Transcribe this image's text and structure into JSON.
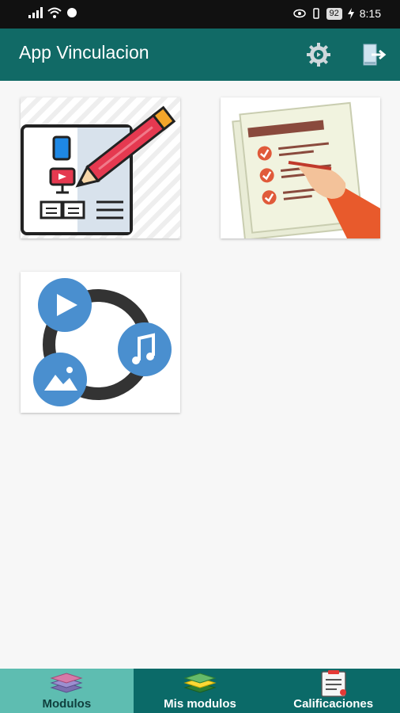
{
  "status_bar": {
    "time": "8:15",
    "battery": "92"
  },
  "app_bar": {
    "title": "App Vinculacion",
    "settings_icon": "gear-icon",
    "logout_icon": "logout-icon"
  },
  "modules": [
    {
      "icon": "pencil-document-icon"
    },
    {
      "icon": "checklist-icon"
    },
    {
      "icon": "multimedia-icon"
    }
  ],
  "bottom_nav": {
    "items": [
      {
        "label": "Modulos",
        "icon": "layers-icon",
        "active": true
      },
      {
        "label": "Mis modulos",
        "icon": "layers-green-icon",
        "active": false
      },
      {
        "label": "Calificaciones",
        "icon": "clipboard-icon",
        "active": false
      }
    ]
  },
  "colors": {
    "app_bar": "#116a66",
    "nav_bar": "#0b6a68",
    "nav_active": "#5ebdb1"
  }
}
